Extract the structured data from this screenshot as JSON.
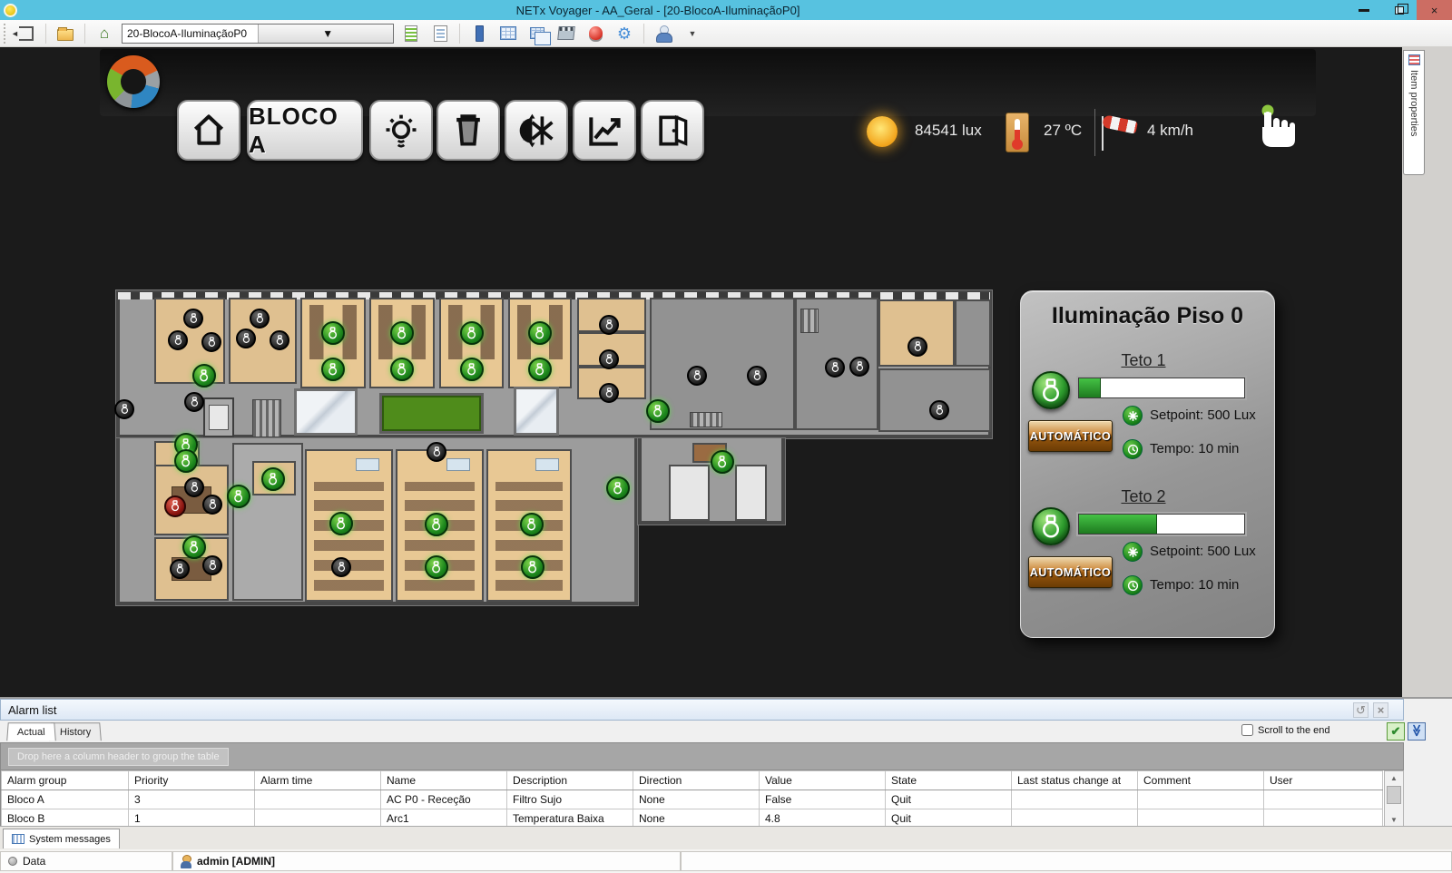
{
  "window": {
    "title": "NETx Voyager - AA_Geral - [20-BlocoA-IluminaçãoP0]"
  },
  "toolbar": {
    "view_selector": "20-BlocoA-IluminaçãoP0"
  },
  "nav": {
    "bloco_label": "BLOCO A"
  },
  "weather": {
    "lux": "84541 lux",
    "temperature": "27 ºC",
    "wind": "4 km/h"
  },
  "right_tab": {
    "label": "Item properties"
  },
  "panel": {
    "title": "Iluminação Piso 0",
    "auto_label": "AUTOMÁTICO",
    "sections": [
      {
        "name": "Teto 1",
        "progress": 13,
        "setpoint": "Setpoint: 500 Lux",
        "tempo": "Tempo: 10 min"
      },
      {
        "name": "Teto 2",
        "progress": 47,
        "setpoint": "Setpoint: 500 Lux",
        "tempo": "Tempo: 10 min"
      }
    ],
    "accent_green": "#1d7a1f",
    "accent_orange": "#96560e"
  },
  "floorplan": {
    "lamps": [
      [
        "b",
        85,
        31
      ],
      [
        "b",
        68,
        55
      ],
      [
        "b",
        105,
        57
      ],
      [
        "b",
        158,
        31
      ],
      [
        "b",
        143,
        53
      ],
      [
        "b",
        180,
        55
      ],
      [
        "b",
        9,
        131
      ],
      [
        "b",
        86,
        123
      ],
      [
        "b",
        543,
        38
      ],
      [
        "b",
        543,
        76
      ],
      [
        "b",
        543,
        113
      ],
      [
        "b",
        640,
        94
      ],
      [
        "b",
        706,
        94
      ],
      [
        "b",
        792,
        85
      ],
      [
        "b",
        819,
        84
      ],
      [
        "b",
        883,
        62
      ],
      [
        "b",
        907,
        132
      ],
      [
        "b",
        86,
        217
      ],
      [
        "b",
        106,
        236
      ],
      [
        "b",
        106,
        303
      ],
      [
        "b",
        70,
        307
      ],
      [
        "b",
        248,
        305
      ],
      [
        "b",
        353,
        178
      ],
      [
        "g",
        97,
        94
      ],
      [
        "g",
        239,
        47
      ],
      [
        "g",
        239,
        87
      ],
      [
        "g",
        315,
        47
      ],
      [
        "g",
        315,
        87
      ],
      [
        "g",
        392,
        47
      ],
      [
        "g",
        392,
        87
      ],
      [
        "g",
        467,
        47
      ],
      [
        "g",
        467,
        87
      ],
      [
        "g",
        597,
        133
      ],
      [
        "g",
        77,
        170
      ],
      [
        "g",
        77,
        188
      ],
      [
        "g",
        86,
        283
      ],
      [
        "g",
        173,
        208
      ],
      [
        "g",
        135,
        227
      ],
      [
        "g",
        248,
        257
      ],
      [
        "g",
        353,
        258
      ],
      [
        "g",
        353,
        305
      ],
      [
        "g",
        458,
        258
      ],
      [
        "g",
        459,
        305
      ],
      [
        "g",
        668,
        189
      ],
      [
        "g",
        553,
        218
      ],
      [
        "r",
        65,
        238
      ]
    ]
  },
  "alarm": {
    "title": "Alarm list",
    "tabs": [
      "Actual",
      "History"
    ],
    "scroll_label": "Scroll to the end",
    "group_hint": "Drop here a column header to group the table",
    "columns": [
      "Alarm group",
      "Priority",
      "Alarm time",
      "Name",
      "Description",
      "Direction",
      "Value",
      "State",
      "Last status change at",
      "Comment",
      "User"
    ],
    "rows": [
      [
        "Bloco A",
        "3",
        "",
        "AC P0 - Receção",
        "Filtro Sujo",
        "None",
        "False",
        "Quit",
        "",
        "",
        ""
      ],
      [
        "Bloco B",
        "1",
        "",
        "Arc1",
        "Temperatura Baixa",
        "None",
        "4.8",
        "Quit",
        "",
        "",
        ""
      ]
    ]
  },
  "system_bar": {
    "label": "System messages"
  },
  "status_bar": {
    "data_label": "Data",
    "user": "admin [ADMIN]"
  }
}
